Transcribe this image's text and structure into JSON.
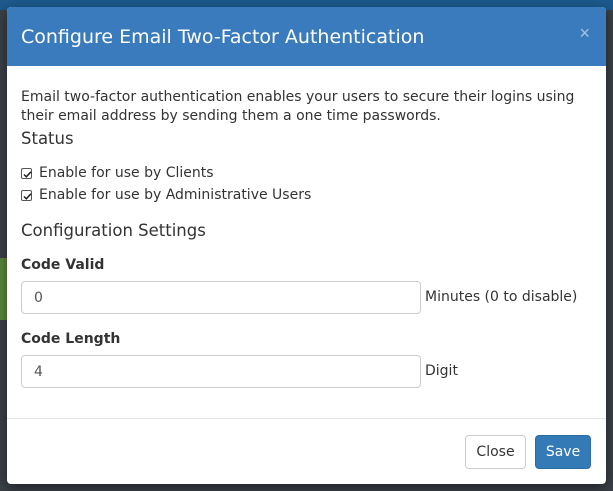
{
  "modal": {
    "title": "Configure Email Two-Factor Authentication",
    "close_icon": "×",
    "description": "Email two-factor authentication enables your users to secure their logins using their email address by sending them a one time passwords."
  },
  "status": {
    "heading": "Status",
    "options": [
      {
        "label": "Enable for use by Clients",
        "checked": true
      },
      {
        "label": "Enable for use by Administrative Users",
        "checked": true
      }
    ]
  },
  "configuration": {
    "heading": "Configuration Settings",
    "code_valid": {
      "label": "Code Valid",
      "value": "0",
      "suffix": "Minutes (0 to disable)"
    },
    "code_length": {
      "label": "Code Length",
      "value": "4",
      "suffix": "Digit"
    }
  },
  "footer": {
    "close_label": "Close",
    "save_label": "Save"
  },
  "colors": {
    "header_bg": "#3a7bbd",
    "primary": "#337ab7"
  }
}
